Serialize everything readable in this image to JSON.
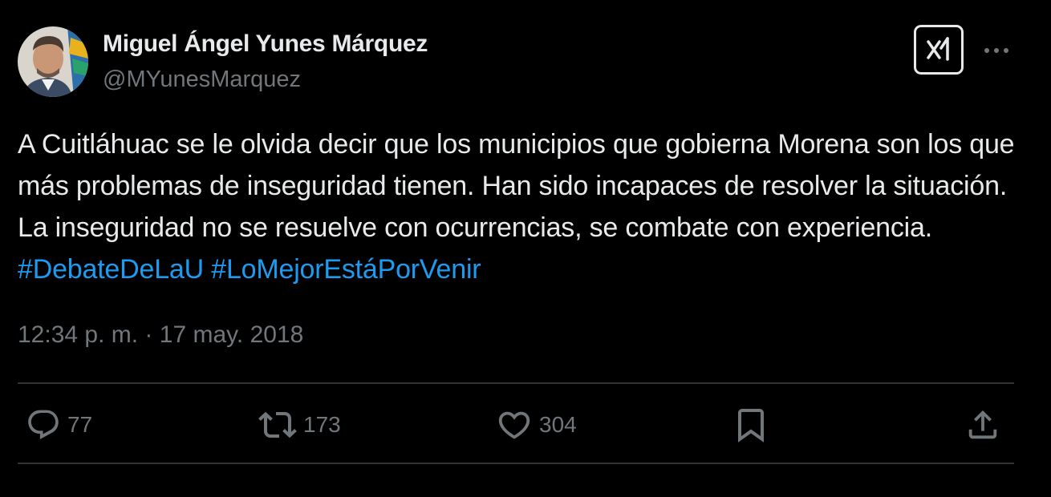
{
  "author": {
    "display_name": "Miguel Ángel Yunes Márquez",
    "handle": "@MYunesMarquez"
  },
  "tweet": {
    "text_plain": "A Cuitláhuac se le olvida decir que los municipios que gobierna Morena son los que más problemas de inseguridad tienen. Han sido incapaces de resolver la situación. La inseguridad no se resuelve con ocurrencias, se combate con experiencia. ",
    "hashtag_1": "#DebateDeLaU",
    "hashtag_2": "#LoMejorEstáPorVenir",
    "time": "12:34 p. m.",
    "separator": " · ",
    "date": "17 may. 2018"
  },
  "actions": {
    "replies": "77",
    "reposts": "173",
    "likes": "304"
  },
  "colors": {
    "background": "#000000",
    "text": "#e7e9ea",
    "secondary": "#71767b",
    "link": "#1d9bf0",
    "divider": "#2f3336"
  },
  "icons": {
    "grok": "grok-icon",
    "more": "more-icon",
    "reply": "reply-icon",
    "repost": "repost-icon",
    "like": "like-icon",
    "bookmark": "bookmark-icon",
    "share": "share-icon"
  }
}
